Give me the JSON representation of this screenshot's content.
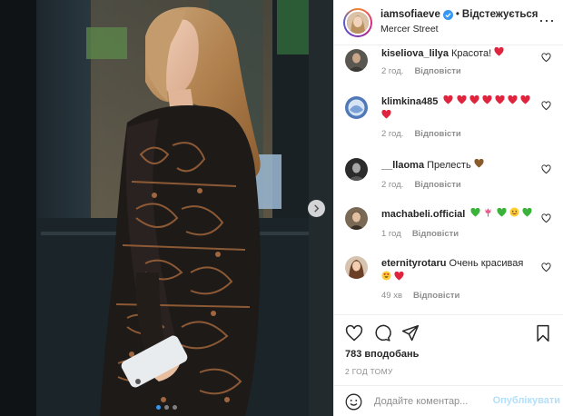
{
  "post": {
    "username": "iamsofiaeve",
    "follow_label": "Відстежується",
    "separator": "•",
    "location": "Mercer Street",
    "more_label": "···",
    "carousel": {
      "slides": 3,
      "active_slide": 1
    }
  },
  "comments": [
    {
      "user": "kiseliova_lilya",
      "text": "Красота!",
      "emoji": [
        "heart"
      ],
      "time": "2 год.",
      "reply_label": "Відповісти"
    },
    {
      "user": "klimkina485",
      "text": "",
      "emoji": [
        "heart",
        "heart",
        "heart",
        "heart",
        "heart",
        "heart",
        "heart",
        "heart"
      ],
      "time": "2 год.",
      "reply_label": "Відповісти"
    },
    {
      "user": "__llaoma",
      "text": "Прелесть",
      "emoji": [
        "brown-heart"
      ],
      "time": "2 год.",
      "reply_label": "Відповісти"
    },
    {
      "user": "machabeli.official",
      "text": "",
      "emoji": [
        "green-heart",
        "tulip",
        "green-heart",
        "smiling-face",
        "green-heart"
      ],
      "time": "1 год",
      "reply_label": "Відповісти"
    },
    {
      "user": "eternityrotaru",
      "text": "Очень красивая",
      "emoji": [
        "heart-eyes",
        "heart"
      ],
      "time": "49 хв",
      "reply_label": "Відповісти"
    }
  ],
  "likes_label": "783 вподобань",
  "timestamp": "2 ГОД ТОМУ",
  "comment_box": {
    "placeholder": "Додайте коментар...",
    "publish_label": "Опублікувати"
  },
  "colors": {
    "accent": "#3897f0",
    "publish_disabled": "#b2dffc",
    "heart": "#ed4956",
    "muted": "#8e8e8e"
  }
}
